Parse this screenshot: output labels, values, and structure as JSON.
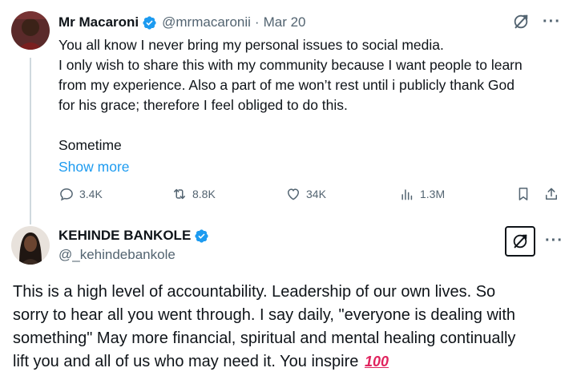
{
  "tweet1": {
    "name": "Mr Macaroni",
    "handle": "@mrmacaronii",
    "separator": "·",
    "date": "Mar 20",
    "body_lines": [
      "You all know I never bring my personal issues to social media.",
      "I only wish to share this with my community because I want people to learn",
      "from my experience. Also a part of me won’t rest until i publicly thank God",
      "for his grace; therefore I feel obliged to do this.",
      "Sometime"
    ],
    "show_more": "Show more",
    "metrics": {
      "replies": "3.4K",
      "reposts": "8.8K",
      "likes": "34K",
      "views": "1.3M"
    }
  },
  "tweet2": {
    "name": "KEHINDE BANKOLE",
    "handle": "@_kehindebankole",
    "body_lines": [
      "This is a high level of accountability. Leadership of our own lives. So",
      "sorry to hear all you went through. I say daily, \"everyone is dealing with",
      "something\" May more financial, spiritual and mental healing continually",
      "lift you and all of us who may need it.  You inspire"
    ],
    "emoji": "100"
  },
  "more_glyph": "···",
  "colors": {
    "accent": "#1d9bf0",
    "text": "#0f1419",
    "muted": "#536471",
    "emoji_red": "#e0245e"
  }
}
